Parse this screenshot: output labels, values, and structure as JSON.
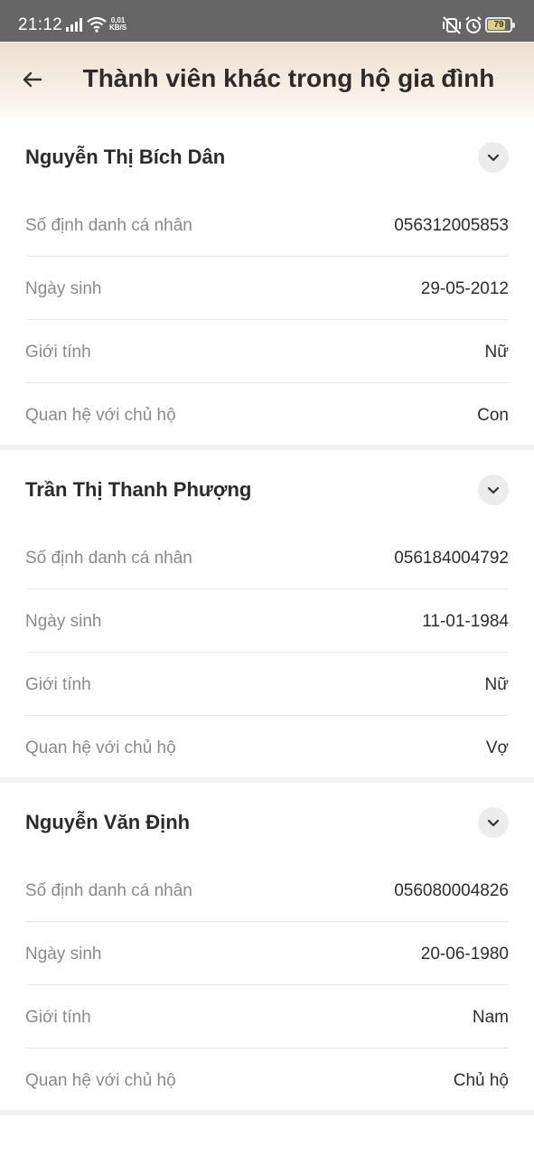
{
  "status_bar": {
    "time": "21:12",
    "net_speed_value": "0,01",
    "net_speed_unit": "KB/S",
    "battery_level": "79",
    "battery_fraction": 0.79
  },
  "header": {
    "title": "Thành viên khác trong hộ gia đình",
    "back_icon": "arrow-left-icon"
  },
  "labels": {
    "id": "Số định danh cá nhân",
    "dob": "Ngày sinh",
    "gender": "Giới tính",
    "relation": "Quan hệ với chủ hộ"
  },
  "members": [
    {
      "name": "Nguyễn Thị Bích Dân",
      "id": "056312005853",
      "dob": "29-05-2012",
      "gender": "Nữ",
      "relation": "Con"
    },
    {
      "name": "Trần Thị Thanh Phượng",
      "id": "056184004792",
      "dob": "11-01-1984",
      "gender": "Nữ",
      "relation": "Vợ"
    },
    {
      "name": "Nguyễn Văn Định",
      "id": "056080004826",
      "dob": "20-06-1980",
      "gender": "Nam",
      "relation": "Chủ hộ"
    }
  ]
}
